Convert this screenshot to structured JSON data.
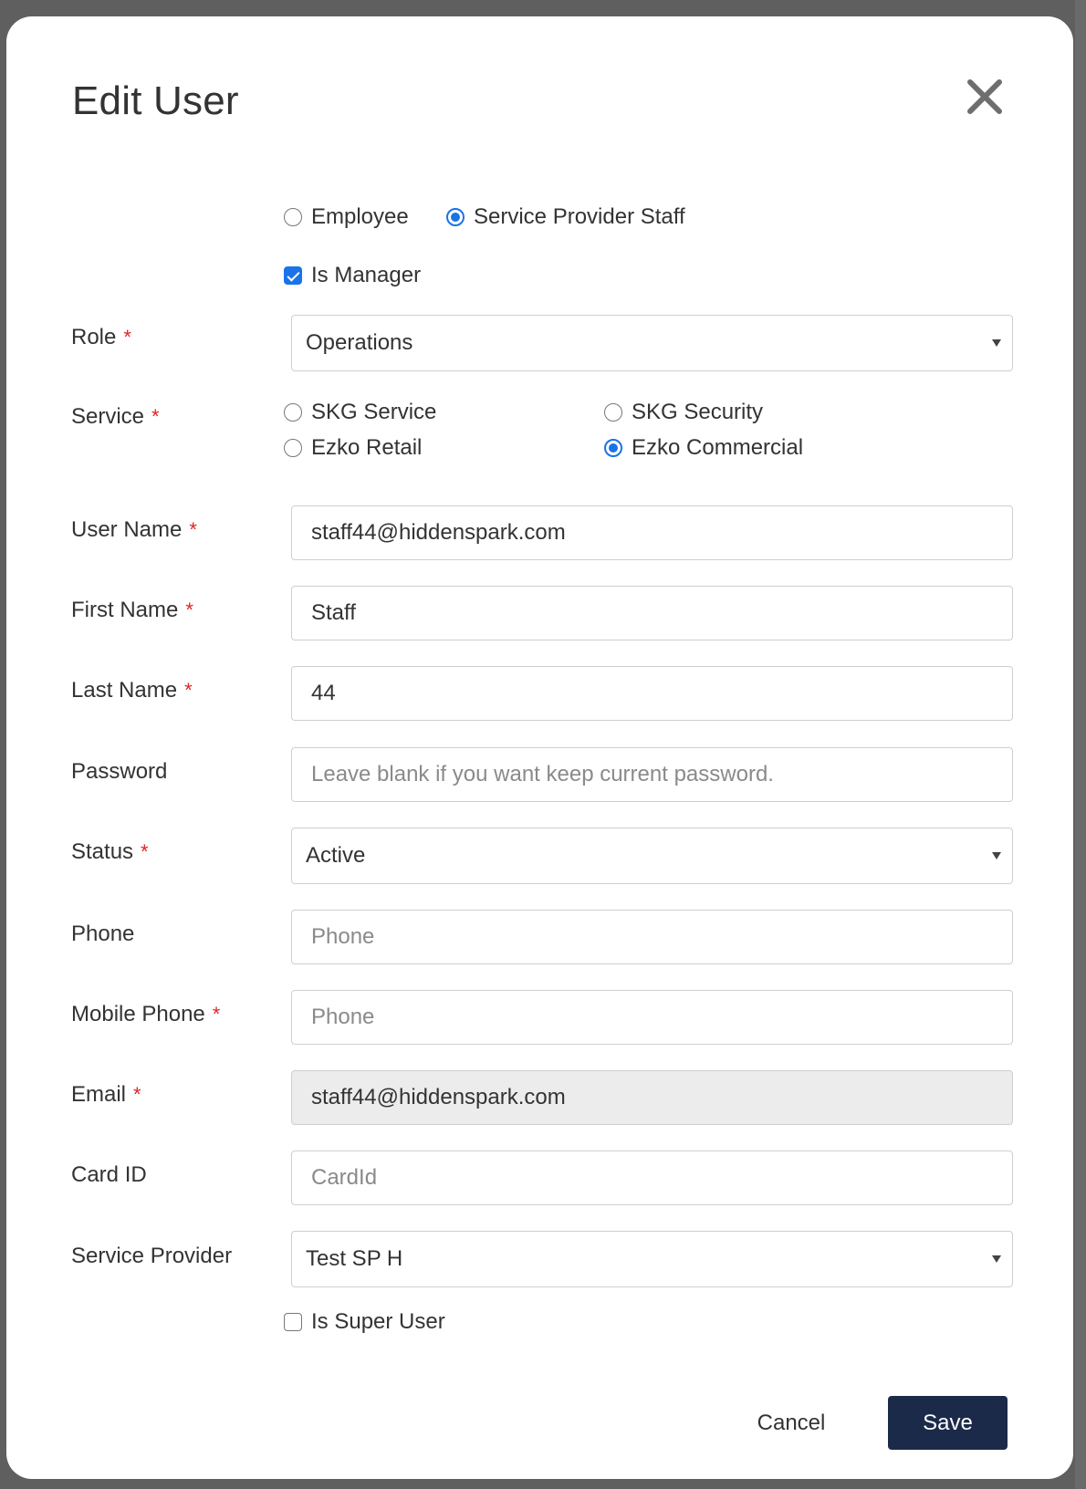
{
  "dialog": {
    "title": "Edit User",
    "close_icon": "close-icon"
  },
  "user_type": {
    "options": [
      {
        "label": "Employee",
        "selected": false
      },
      {
        "label": "Service Provider Staff",
        "selected": true
      }
    ]
  },
  "is_manager": {
    "label": "Is Manager",
    "checked": true
  },
  "role": {
    "label": "Role",
    "required_mark": "*",
    "value": "Operations"
  },
  "service": {
    "label": "Service",
    "required_mark": "*",
    "options": [
      {
        "label": "SKG Service",
        "selected": false
      },
      {
        "label": "SKG Security",
        "selected": false
      },
      {
        "label": "Ezko Retail",
        "selected": false
      },
      {
        "label": "Ezko Commercial",
        "selected": true
      }
    ]
  },
  "user_name": {
    "label": "User Name",
    "required_mark": "*",
    "value": "staff44@hiddenspark.com"
  },
  "first_name": {
    "label": "First Name",
    "required_mark": "*",
    "value": "Staff"
  },
  "last_name": {
    "label": "Last Name",
    "required_mark": "*",
    "value": "44"
  },
  "password": {
    "label": "Password",
    "placeholder": "Leave blank if you want keep current password."
  },
  "status": {
    "label": "Status",
    "required_mark": "*",
    "value": "Active"
  },
  "phone": {
    "label": "Phone",
    "placeholder": "Phone"
  },
  "mobile_phone": {
    "label": "Mobile Phone",
    "required_mark": "*",
    "placeholder": "Phone"
  },
  "email": {
    "label": "Email",
    "required_mark": "*",
    "value": "staff44@hiddenspark.com",
    "disabled": true
  },
  "card_id": {
    "label": "Card ID",
    "placeholder": "CardId"
  },
  "service_provider": {
    "label": "Service Provider",
    "value": "Test SP H"
  },
  "is_super_user": {
    "label": "Is Super User",
    "checked": false
  },
  "actions": {
    "cancel": "Cancel",
    "save": "Save"
  },
  "colors": {
    "accent": "#1a73e8",
    "primary_button": "#1c2a4a",
    "required": "#e02424",
    "overlay": "#5f5f5f"
  }
}
